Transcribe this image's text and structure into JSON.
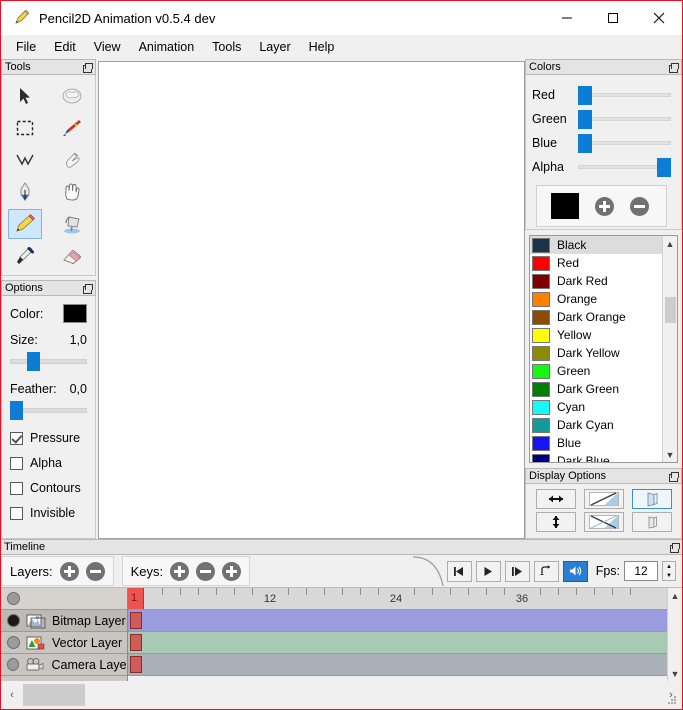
{
  "window": {
    "title": "Pencil2D Animation v0.5.4 dev",
    "app_icon": "pencil-icon",
    "minimize": "—",
    "maximize": "☐",
    "close": "✕"
  },
  "menu": {
    "items": [
      {
        "label": "File"
      },
      {
        "label": "Edit"
      },
      {
        "label": "View"
      },
      {
        "label": "Animation"
      },
      {
        "label": "Tools"
      },
      {
        "label": "Layer"
      },
      {
        "label": "Help"
      }
    ]
  },
  "tools_panel": {
    "title": "Tools",
    "items": [
      {
        "name": "select-tool",
        "selected": false
      },
      {
        "name": "smudge-tool",
        "selected": false
      },
      {
        "name": "marquee-tool",
        "selected": false
      },
      {
        "name": "brush-tool",
        "selected": false
      },
      {
        "name": "polyline-tool",
        "selected": false
      },
      {
        "name": "finger-smudge-tool",
        "selected": false
      },
      {
        "name": "pen-tool",
        "selected": false
      },
      {
        "name": "hand-tool",
        "selected": false
      },
      {
        "name": "pencil-tool",
        "selected": true
      },
      {
        "name": "bucket-tool",
        "selected": false
      },
      {
        "name": "eyedropper-tool",
        "selected": false
      },
      {
        "name": "eraser-tool",
        "selected": false
      }
    ]
  },
  "options_panel": {
    "title": "Options",
    "color_label": "Color:",
    "color_value": "#000000",
    "size_label": "Size:",
    "size_value": "1,0",
    "size_percent": 25,
    "feather_label": "Feather:",
    "feather_value": "0,0",
    "feather_percent": 0,
    "checkboxes": [
      {
        "label": "Pressure",
        "checked": true
      },
      {
        "label": "Alpha",
        "checked": false
      },
      {
        "label": "Contours",
        "checked": false
      },
      {
        "label": "Invisible",
        "checked": false
      }
    ]
  },
  "colors_panel": {
    "title": "Colors",
    "sliders": [
      {
        "label": "Red",
        "percent": 0
      },
      {
        "label": "Green",
        "percent": 0
      },
      {
        "label": "Blue",
        "percent": 0
      },
      {
        "label": "Alpha",
        "percent": 100
      }
    ],
    "current_color": "#000000",
    "add_button": "add-color-button",
    "remove_button": "remove-color-button"
  },
  "palette": {
    "selected_index": 0,
    "items": [
      {
        "name": "Black",
        "color": "#1a3349"
      },
      {
        "name": "Red",
        "color": "#fe0000"
      },
      {
        "name": "Dark Red",
        "color": "#800000"
      },
      {
        "name": "Orange",
        "color": "#ff8000"
      },
      {
        "name": "Dark Orange",
        "color": "#8f4b00"
      },
      {
        "name": "Yellow",
        "color": "#ffff00"
      },
      {
        "name": "Dark Yellow",
        "color": "#8b8b08"
      },
      {
        "name": "Green",
        "color": "#14f814"
      },
      {
        "name": "Dark Green",
        "color": "#008000"
      },
      {
        "name": "Cyan",
        "color": "#17f9f9"
      },
      {
        "name": "Dark Cyan",
        "color": "#139a9a"
      },
      {
        "name": "Blue",
        "color": "#1515f2"
      },
      {
        "name": "Dark Blue",
        "color": "#00007f"
      }
    ]
  },
  "display_options": {
    "title": "Display Options",
    "buttons": [
      {
        "name": "flip-horizontal-button",
        "selected": false
      },
      {
        "name": "angle-lines-single-button",
        "selected": false
      },
      {
        "name": "perspective-1-button",
        "selected": true
      },
      {
        "name": "flip-vertical-button",
        "selected": false
      },
      {
        "name": "angle-lines-cross-button",
        "selected": false
      },
      {
        "name": "perspective-2-button",
        "selected": false
      }
    ]
  },
  "timeline": {
    "title": "Timeline",
    "layers_label": "Layers:",
    "layers_add": "add-layer-button",
    "layers_remove": "remove-layer-button",
    "keys_label": "Keys:",
    "keys_add": "add-key-button",
    "keys_remove": "remove-key-button",
    "keys_duplicate": "duplicate-key-button",
    "playback": {
      "previous_frame": "previous-frame-button",
      "play": "play-button",
      "next_frame": "next-frame-button",
      "loop": "loop-button",
      "sound": "sound-button",
      "sound_active": true,
      "fps_label": "Fps:",
      "fps_value": "12"
    },
    "ruler": {
      "current_frame": "1",
      "marks": [
        "12",
        "24",
        "36"
      ]
    },
    "layers": [
      {
        "name": "Bitmap Layer",
        "icon": "bitmap-layer-icon",
        "visible": true,
        "selected": true,
        "track_color": "#9b9be0"
      },
      {
        "name": "Vector Layer",
        "icon": "vector-layer-icon",
        "visible": false,
        "selected": false,
        "track_color": "#a8c9b4"
      },
      {
        "name": "Camera Layer",
        "icon": "camera-layer-icon",
        "visible": false,
        "selected": false,
        "track_color": "#a9b0b8"
      }
    ],
    "hscroll": {
      "left_arrow": "‹",
      "right_arrow": "›"
    }
  }
}
